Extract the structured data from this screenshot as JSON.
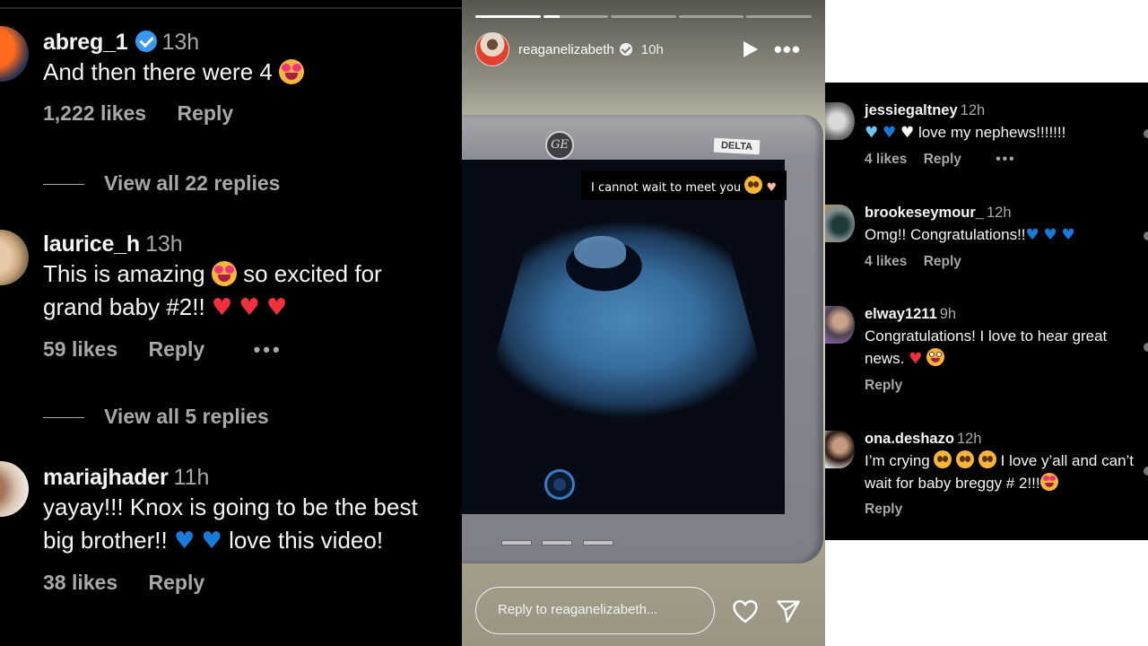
{
  "left_comments": {
    "items": [
      {
        "username": "abreg_1",
        "verified": true,
        "time": "13h",
        "text_parts": [
          "And then there were 4 "
        ],
        "emojis": [
          "smiling-face-with-heart-eyes"
        ],
        "likes": "1,222 likes",
        "reply": "Reply",
        "view_replies": "View all 22 replies"
      },
      {
        "username": "laurice_h",
        "verified": false,
        "time": "13h",
        "text_a": "This is amazing ",
        "text_b": " so excited for grand baby #2!! ",
        "emojis": [
          "star-struck",
          "red-heart",
          "red-heart",
          "red-heart"
        ],
        "likes": "59 likes",
        "reply": "Reply",
        "more": "•••",
        "view_replies": "View all 5 replies"
      },
      {
        "username": "mariajhader",
        "verified": false,
        "time": "11h",
        "text_a": "yayay!!! Knox is going to be the best big brother!! ",
        "text_b": " love this video!",
        "emojis": [
          "blue-heart",
          "blue-heart"
        ],
        "likes": "38 likes",
        "reply": "Reply"
      }
    ]
  },
  "story": {
    "username": "reaganelizabeth",
    "verified": true,
    "time": "10h",
    "progress_segments": [
      1.0,
      0.25,
      0.0,
      0.0,
      0.0
    ],
    "caption": "I cannot wait to meet you",
    "caption_emojis": [
      "face-holding-back-tears",
      "heart-hands"
    ],
    "monitor_brand": "GE",
    "monitor_label": "DELTA",
    "reply_placeholder": "Reply to reaganelizabeth...",
    "colors": {
      "ultrasound": "#4c87b9",
      "caption_bg": "#000000"
    }
  },
  "right_comments": {
    "items": [
      {
        "username": "jessiegaltney",
        "time": "12h",
        "text": " love my nephews!!!!!!!",
        "emojis": [
          "light-blue-heart",
          "blue-heart",
          "white-heart"
        ],
        "likes": "4 likes",
        "reply": "Reply",
        "more": "•••"
      },
      {
        "username": "brookeseymour_",
        "time": "12h",
        "text": "Omg!! Congratulations!!",
        "emojis": [
          "blue-heart",
          "blue-heart",
          "blue-heart"
        ],
        "likes": "4 likes",
        "reply": "Reply"
      },
      {
        "username": "elway1211",
        "time": "9h",
        "text": "Congratulations! I love to hear great news. ",
        "emojis": [
          "red-heart",
          "grinning-face-big-eyes"
        ],
        "reply": "Reply"
      },
      {
        "username": "ona.deshazo",
        "time": "12h",
        "text_a": "I’m crying ",
        "text_b": " I love y’all and can’t wait for baby breggy # 2!!!",
        "emojis": [
          "pleading-face",
          "pleading-face",
          "pleading-face",
          "smiling-face-with-heart-eyes"
        ],
        "reply": "Reply"
      }
    ]
  },
  "glyphs": {
    "heart": "♥"
  },
  "colors": {
    "panel_bg": "#000000",
    "text": "#f5f5f5",
    "muted": "#a8a8a8",
    "verified": "#3897f0",
    "red_heart": "#f1303c",
    "blue_heart": "#1a7ad9"
  }
}
